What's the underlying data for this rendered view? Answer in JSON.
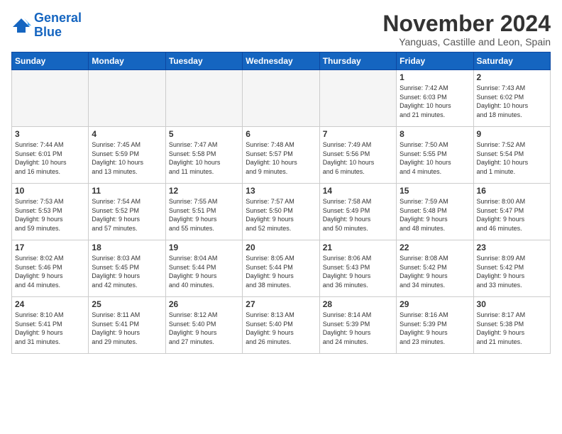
{
  "logo": {
    "line1": "General",
    "line2": "Blue"
  },
  "header": {
    "month": "November 2024",
    "location": "Yanguas, Castille and Leon, Spain"
  },
  "weekdays": [
    "Sunday",
    "Monday",
    "Tuesday",
    "Wednesday",
    "Thursday",
    "Friday",
    "Saturday"
  ],
  "weeks": [
    [
      {
        "day": "",
        "info": ""
      },
      {
        "day": "",
        "info": ""
      },
      {
        "day": "",
        "info": ""
      },
      {
        "day": "",
        "info": ""
      },
      {
        "day": "",
        "info": ""
      },
      {
        "day": "1",
        "info": "Sunrise: 7:42 AM\nSunset: 6:03 PM\nDaylight: 10 hours\nand 21 minutes."
      },
      {
        "day": "2",
        "info": "Sunrise: 7:43 AM\nSunset: 6:02 PM\nDaylight: 10 hours\nand 18 minutes."
      }
    ],
    [
      {
        "day": "3",
        "info": "Sunrise: 7:44 AM\nSunset: 6:01 PM\nDaylight: 10 hours\nand 16 minutes."
      },
      {
        "day": "4",
        "info": "Sunrise: 7:45 AM\nSunset: 5:59 PM\nDaylight: 10 hours\nand 13 minutes."
      },
      {
        "day": "5",
        "info": "Sunrise: 7:47 AM\nSunset: 5:58 PM\nDaylight: 10 hours\nand 11 minutes."
      },
      {
        "day": "6",
        "info": "Sunrise: 7:48 AM\nSunset: 5:57 PM\nDaylight: 10 hours\nand 9 minutes."
      },
      {
        "day": "7",
        "info": "Sunrise: 7:49 AM\nSunset: 5:56 PM\nDaylight: 10 hours\nand 6 minutes."
      },
      {
        "day": "8",
        "info": "Sunrise: 7:50 AM\nSunset: 5:55 PM\nDaylight: 10 hours\nand 4 minutes."
      },
      {
        "day": "9",
        "info": "Sunrise: 7:52 AM\nSunset: 5:54 PM\nDaylight: 10 hours\nand 1 minute."
      }
    ],
    [
      {
        "day": "10",
        "info": "Sunrise: 7:53 AM\nSunset: 5:53 PM\nDaylight: 9 hours\nand 59 minutes."
      },
      {
        "day": "11",
        "info": "Sunrise: 7:54 AM\nSunset: 5:52 PM\nDaylight: 9 hours\nand 57 minutes."
      },
      {
        "day": "12",
        "info": "Sunrise: 7:55 AM\nSunset: 5:51 PM\nDaylight: 9 hours\nand 55 minutes."
      },
      {
        "day": "13",
        "info": "Sunrise: 7:57 AM\nSunset: 5:50 PM\nDaylight: 9 hours\nand 52 minutes."
      },
      {
        "day": "14",
        "info": "Sunrise: 7:58 AM\nSunset: 5:49 PM\nDaylight: 9 hours\nand 50 minutes."
      },
      {
        "day": "15",
        "info": "Sunrise: 7:59 AM\nSunset: 5:48 PM\nDaylight: 9 hours\nand 48 minutes."
      },
      {
        "day": "16",
        "info": "Sunrise: 8:00 AM\nSunset: 5:47 PM\nDaylight: 9 hours\nand 46 minutes."
      }
    ],
    [
      {
        "day": "17",
        "info": "Sunrise: 8:02 AM\nSunset: 5:46 PM\nDaylight: 9 hours\nand 44 minutes."
      },
      {
        "day": "18",
        "info": "Sunrise: 8:03 AM\nSunset: 5:45 PM\nDaylight: 9 hours\nand 42 minutes."
      },
      {
        "day": "19",
        "info": "Sunrise: 8:04 AM\nSunset: 5:44 PM\nDaylight: 9 hours\nand 40 minutes."
      },
      {
        "day": "20",
        "info": "Sunrise: 8:05 AM\nSunset: 5:44 PM\nDaylight: 9 hours\nand 38 minutes."
      },
      {
        "day": "21",
        "info": "Sunrise: 8:06 AM\nSunset: 5:43 PM\nDaylight: 9 hours\nand 36 minutes."
      },
      {
        "day": "22",
        "info": "Sunrise: 8:08 AM\nSunset: 5:42 PM\nDaylight: 9 hours\nand 34 minutes."
      },
      {
        "day": "23",
        "info": "Sunrise: 8:09 AM\nSunset: 5:42 PM\nDaylight: 9 hours\nand 33 minutes."
      }
    ],
    [
      {
        "day": "24",
        "info": "Sunrise: 8:10 AM\nSunset: 5:41 PM\nDaylight: 9 hours\nand 31 minutes."
      },
      {
        "day": "25",
        "info": "Sunrise: 8:11 AM\nSunset: 5:41 PM\nDaylight: 9 hours\nand 29 minutes."
      },
      {
        "day": "26",
        "info": "Sunrise: 8:12 AM\nSunset: 5:40 PM\nDaylight: 9 hours\nand 27 minutes."
      },
      {
        "day": "27",
        "info": "Sunrise: 8:13 AM\nSunset: 5:40 PM\nDaylight: 9 hours\nand 26 minutes."
      },
      {
        "day": "28",
        "info": "Sunrise: 8:14 AM\nSunset: 5:39 PM\nDaylight: 9 hours\nand 24 minutes."
      },
      {
        "day": "29",
        "info": "Sunrise: 8:16 AM\nSunset: 5:39 PM\nDaylight: 9 hours\nand 23 minutes."
      },
      {
        "day": "30",
        "info": "Sunrise: 8:17 AM\nSunset: 5:38 PM\nDaylight: 9 hours\nand 21 minutes."
      }
    ]
  ]
}
